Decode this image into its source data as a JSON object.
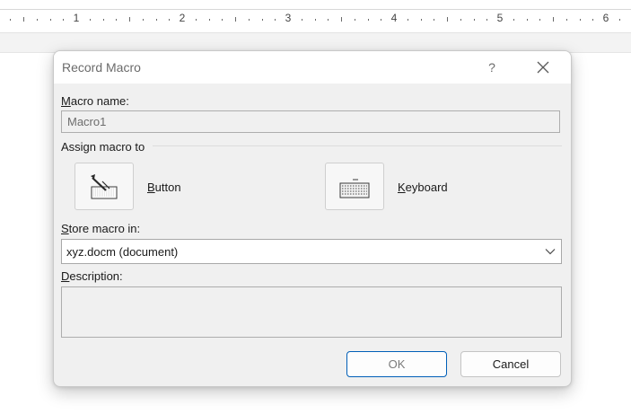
{
  "ruler": {
    "numbers": [
      "1",
      "2",
      "3",
      "4",
      "5",
      "6"
    ]
  },
  "dialog": {
    "title": "Record Macro",
    "help_glyph": "?",
    "macro_name_label": {
      "accel": "M",
      "rest": "acro name:"
    },
    "macro_name_value": "Macro1",
    "assign_label": "Assign macro to",
    "button_option": {
      "accel": "B",
      "rest": "utton",
      "icon": "button-assign-icon"
    },
    "keyboard_option": {
      "accel": "K",
      "rest": "eyboard",
      "icon": "keyboard-icon"
    },
    "store_label": {
      "accel": "S",
      "rest": "tore macro in:"
    },
    "store_value": "xyz.docm (document)",
    "description_label": {
      "accel": "D",
      "rest": "escription:"
    },
    "description_value": "",
    "ok_label": "OK",
    "cancel_label": "Cancel"
  },
  "colors": {
    "dialog_bg": "#f0f0f0",
    "titlebar_bg": "#ffffff",
    "default_button_border": "#005fb8"
  }
}
